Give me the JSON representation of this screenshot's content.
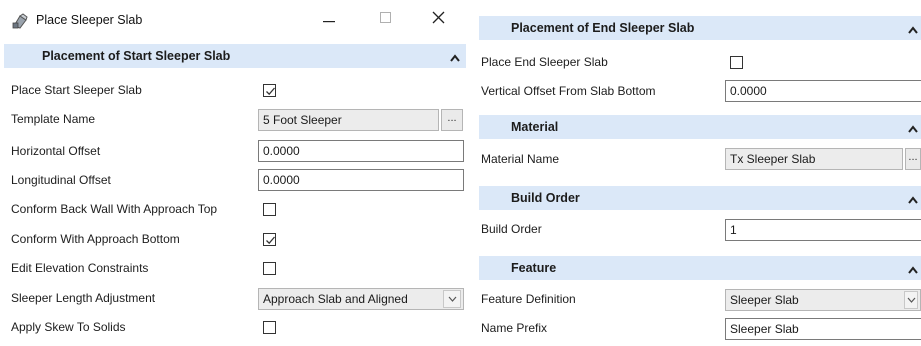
{
  "window": {
    "title": "Place Sleeper Slab",
    "minimize_glyph": "—",
    "maximize_glyph": "☐",
    "close_glyph": "✕"
  },
  "start_section": {
    "header": "Placement of Start Sleeper Slab",
    "rows": {
      "place_start": {
        "label": "Place Start Sleeper Slab",
        "checked": true
      },
      "template_name": {
        "label": "Template Name",
        "value": "5 Foot Sleeper",
        "button": "..."
      },
      "horizontal_offset": {
        "label": "Horizontal Offset",
        "value": "0.0000"
      },
      "longitudinal_offset": {
        "label": "Longitudinal Offset",
        "value": "0.0000"
      },
      "conform_back_wall": {
        "label": "Conform Back Wall With Approach Top",
        "checked": false
      },
      "conform_approach_bottom": {
        "label": "Conform With Approach Bottom",
        "checked": true
      },
      "edit_elevation": {
        "label": "Edit Elevation Constraints",
        "checked": false
      },
      "sleeper_length": {
        "label": "Sleeper Length Adjustment",
        "value": "Approach Slab and Aligned"
      },
      "apply_skew": {
        "label": "Apply Skew To Solids",
        "checked": false
      }
    }
  },
  "end_section": {
    "header": "Placement of End Sleeper Slab",
    "rows": {
      "place_end": {
        "label": "Place End Sleeper Slab",
        "checked": false
      },
      "vertical_offset": {
        "label": "Vertical Offset From Slab Bottom",
        "value": "0.0000"
      }
    }
  },
  "material_section": {
    "header": "Material",
    "rows": {
      "material_name": {
        "label": "Material Name",
        "value": "Tx Sleeper Slab",
        "button": "..."
      }
    }
  },
  "build_order_section": {
    "header": "Build Order",
    "rows": {
      "build_order": {
        "label": "Build Order",
        "value": "1"
      }
    }
  },
  "feature_section": {
    "header": "Feature",
    "rows": {
      "feature_definition": {
        "label": "Feature Definition",
        "value": "Sleeper Slab"
      },
      "name_prefix": {
        "label": "Name Prefix",
        "value": "Sleeper Slab"
      }
    }
  },
  "colors": {
    "section_header_bg": "#dbe8f8",
    "readonly_bg": "#ececec"
  }
}
